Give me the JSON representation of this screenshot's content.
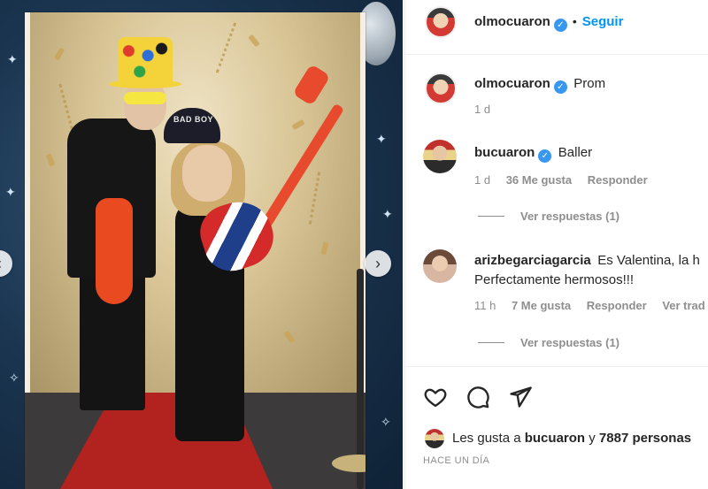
{
  "photo": {
    "hat_text": "BAD BOY",
    "next_arrow": "›",
    "prev_arrow": "‹"
  },
  "header": {
    "username": "olmocuaron",
    "verified": "✓",
    "separator": "•",
    "follow_label": "Seguir"
  },
  "caption": {
    "username": "olmocuaron",
    "verified": "✓",
    "text": "Prom",
    "time": "1 d"
  },
  "comments": [
    {
      "username": "bucuaron",
      "verified": "✓",
      "text": "Baller",
      "time": "1 d",
      "likes": "36 Me gusta",
      "reply_label": "Responder",
      "view_replies": "Ver respuestas (1)"
    },
    {
      "username": "arizbegarciagarcia",
      "text": "Es Valentina, la h",
      "text_line2": "Perfectamente hermosos!!!",
      "time": "11 h",
      "likes": "7 Me gusta",
      "reply_label": "Responder",
      "translate_label": "Ver trad",
      "view_replies": "Ver respuestas (1)"
    }
  ],
  "actions": {
    "like_icon": "heart-icon",
    "comment_icon": "comment-icon",
    "share_icon": "share-icon"
  },
  "likes": {
    "prefix": "Les gusta a ",
    "user": "bucuaron",
    "middle": " y ",
    "count": "7887 personas"
  },
  "timestamp": "HACE UN DÍA",
  "colors": {
    "link_blue": "#0095f6",
    "verified_blue": "#3897f0",
    "meta_gray": "#8e8e8e",
    "text": "#262626"
  }
}
